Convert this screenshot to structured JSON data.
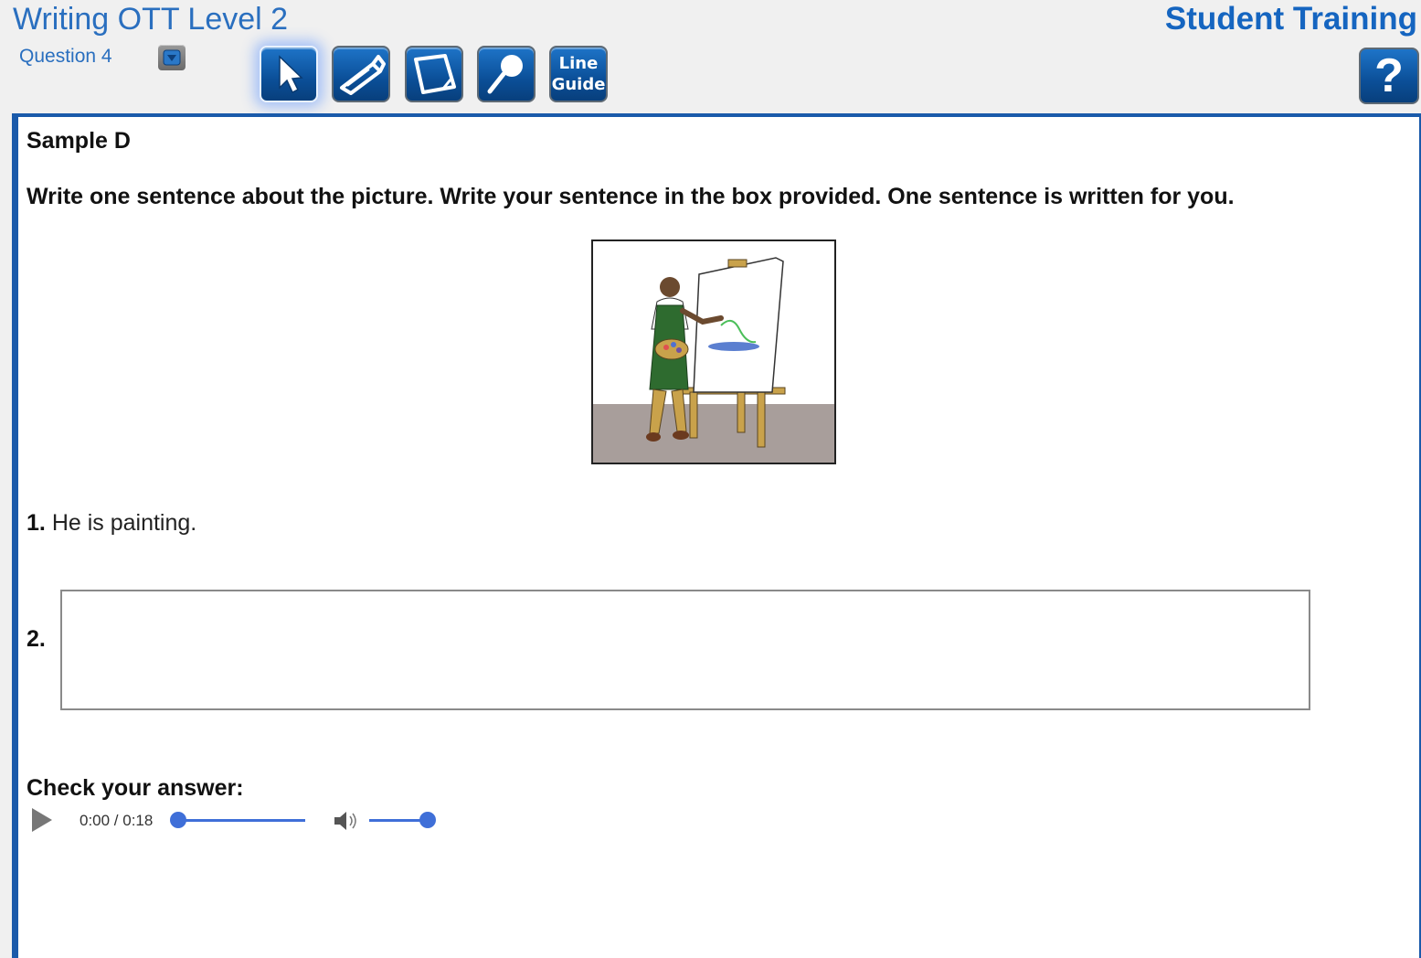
{
  "header": {
    "title": "Writing OTT Level 2",
    "question_label": "Question 4",
    "brand": "Student Training",
    "help_label": "?"
  },
  "toolbar": {
    "tools": [
      {
        "name": "pointer-tool",
        "icon": "pointer-arrow-icon"
      },
      {
        "name": "highlighter-tool",
        "icon": "highlighter-icon"
      },
      {
        "name": "sticky-note-tool",
        "icon": "sticky-note-icon"
      },
      {
        "name": "magnifier-tool",
        "icon": "magnifier-icon"
      },
      {
        "name": "line-guide-tool",
        "label_line1": "Line",
        "label_line2": "Guide"
      }
    ],
    "active_tool": "pointer-tool",
    "accent_color": "#0b4f98"
  },
  "content": {
    "sample_title": "Sample D",
    "instructions": "Write one sentence about the picture. Write your sentence in the box provided. One sentence is written for you.",
    "picture_icon": "man-painting-at-easel-illustration",
    "item1_number": "1.",
    "item1_text": "He is painting.",
    "item2_number": "2.",
    "answer_value": "",
    "check_label": "Check your answer:"
  },
  "audio": {
    "time": "0:00 / 0:18",
    "progress": 0,
    "volume": 1.0,
    "accent_color": "#3f6fd8"
  }
}
